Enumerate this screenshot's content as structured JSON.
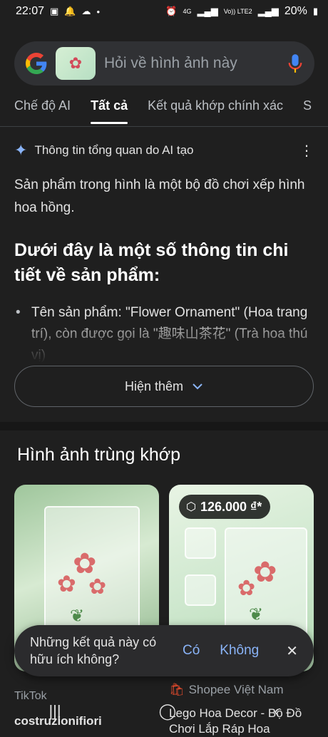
{
  "status_bar": {
    "time": "22:07",
    "network_4g": "4G",
    "volte": "Vo)) LTE2",
    "battery": "20%"
  },
  "search": {
    "placeholder": "Hỏi về hình ảnh này"
  },
  "tabs": [
    {
      "label": "Chế độ AI"
    },
    {
      "label": "Tất cả"
    },
    {
      "label": "Kết quả khớp chính xác"
    },
    {
      "label": "S"
    }
  ],
  "ai_overview": {
    "header": "Thông tin tổng quan do AI tạo",
    "summary": "Sản phẩm trong hình là một bộ đồ chơi xếp hình hoa hồng.",
    "heading": "Dưới đây là một số thông tin chi tiết về sản phẩm:",
    "bullet": "Tên sản phẩm: \"Flower Ornament\" (Hoa trang trí), còn được gọi là \"趣味山茶花\" (Trà hoa thú vị)",
    "show_more": "Hiện thêm"
  },
  "matches": {
    "title": "Hình ảnh trùng khớp",
    "price": "126.000 ₫*",
    "left_source": "TikTok",
    "left_title": "costruzionifiori",
    "right_source": "Shopee Việt Nam",
    "right_title": "Lego Hoa Decor - Bộ Đồ Chơi Lắp Ráp Hoa"
  },
  "feedback": {
    "question": "Những kết quả này có hữu ích không?",
    "yes": "Có",
    "no": "Không"
  },
  "icons": {
    "google": "google-logo",
    "mic": "mic-icon",
    "sparkle": "sparkle-icon"
  }
}
